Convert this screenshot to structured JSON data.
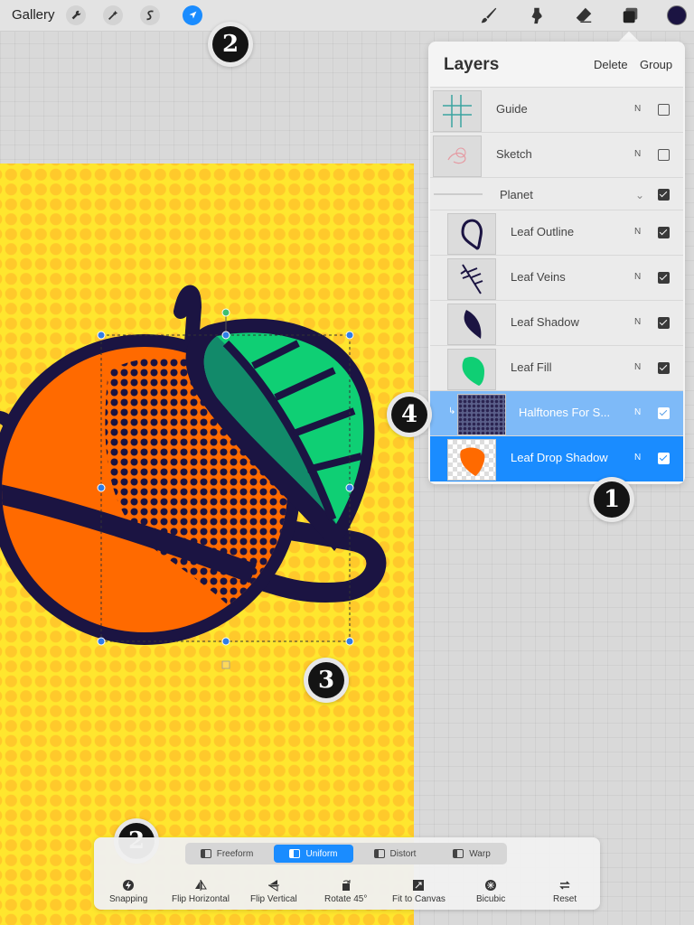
{
  "topbar": {
    "gallery_label": "Gallery",
    "tools_left": [
      "wrench-icon",
      "magic-wand-icon",
      "selection-s-icon",
      "transform-arrow-icon"
    ],
    "tools_right": [
      "brush-icon",
      "smudge-icon",
      "eraser-icon",
      "layers-icon"
    ],
    "active_tool": "transform-arrow-icon",
    "current_color": "#1b1442"
  },
  "layers": {
    "title": "Layers",
    "delete_label": "Delete",
    "group_label": "Group",
    "rows": [
      {
        "name": "Guide",
        "blend": "N",
        "visible": false
      },
      {
        "name": "Sketch",
        "blend": "N",
        "visible": false
      },
      {
        "name": "Planet",
        "blend": "",
        "visible": true,
        "group": true
      },
      {
        "name": "Leaf Outline",
        "blend": "N",
        "visible": true
      },
      {
        "name": "Leaf Veins",
        "blend": "N",
        "visible": true
      },
      {
        "name": "Leaf Shadow",
        "blend": "N",
        "visible": true
      },
      {
        "name": "Leaf Fill",
        "blend": "N",
        "visible": true
      },
      {
        "name": "Halftones For S...",
        "blend": "N",
        "visible": true,
        "state": "secondary-selected"
      },
      {
        "name": "Leaf Drop Shadow",
        "blend": "N",
        "visible": true,
        "state": "primary-selected"
      }
    ]
  },
  "badges": [
    "2",
    "1",
    "4",
    "3",
    "2"
  ],
  "transform": {
    "modes": [
      "Freeform",
      "Uniform",
      "Distort",
      "Warp"
    ],
    "active_mode": "Uniform",
    "actions": [
      "Snapping",
      "Flip Horizontal",
      "Flip Vertical",
      "Rotate 45°",
      "Fit to Canvas",
      "Bicubic",
      "Reset"
    ]
  },
  "colors": {
    "accent": "#1a8cff",
    "canvas_yellow": "#ffe62e",
    "orange": "#ff6a00",
    "navy": "#1b1442",
    "leaf_green": "#0fcf74"
  }
}
